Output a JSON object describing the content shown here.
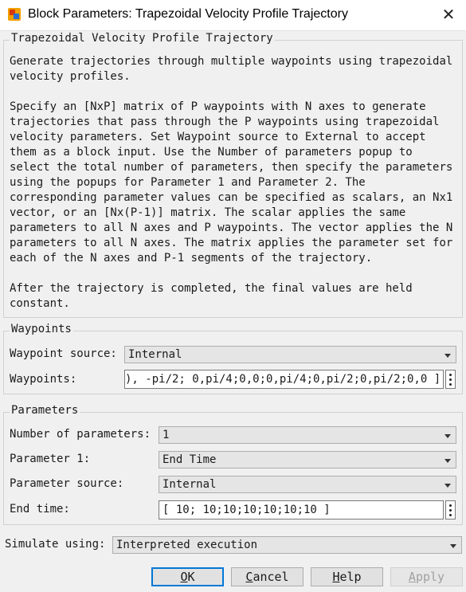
{
  "window": {
    "title": "Block Parameters: Trapezoidal Velocity Profile Trajectory",
    "close_glyph": "✕"
  },
  "block": {
    "name": "Trapezoidal Velocity Profile Trajectory",
    "description": "Generate trajectories through multiple waypoints using trapezoidal\nvelocity profiles.\n\nSpecify an [NxP] matrix of P waypoints with N axes to generate\ntrajectories that pass through the P waypoints using trapezoidal\nvelocity parameters. Set Waypoint source to External to accept\nthem as a block input. Use the Number of parameters popup to\nselect the total number of parameters, then specify the parameters\nusing the popups for Parameter 1 and Parameter 2. The\ncorresponding parameter values can be specified as scalars, an Nx1\nvector, or an [Nx(P-1)] matrix. The scalar applies the same\nparameters to all N axes and P waypoints. The vector applies the N\nparameters to all N axes. The matrix applies the parameter set for\neach of the N axes and P-1 segments of the trajectory.\n\nAfter the trajectory is completed, the final values are held\nconstant."
  },
  "waypoints": {
    "group_title": "Waypoints",
    "source_label": "Waypoint source:",
    "source_value": "Internal",
    "waypoints_label": "Waypoints:",
    "waypoints_value": "), -pi/2; 0,pi/4;0,0;0,pi/4;0,pi/2;0,pi/2;0,0 ]"
  },
  "parameters": {
    "group_title": "Parameters",
    "num_label": "Number of parameters:",
    "num_value": "1",
    "param1_label": "Parameter 1:",
    "param1_value": "End Time",
    "source_label": "Parameter source:",
    "source_value": "Internal",
    "endtime_label": "End time:",
    "endtime_value": "[ 10; 10;10;10;10;10;10 ]"
  },
  "simulate": {
    "label": "Simulate using:",
    "value": "Interpreted execution"
  },
  "buttons": {
    "ok": {
      "first": "O",
      "rest": "K"
    },
    "cancel": {
      "first": "C",
      "rest": "ancel"
    },
    "help": {
      "first": "H",
      "rest": "elp"
    },
    "apply": {
      "first": "A",
      "rest": "pply"
    }
  },
  "icons": {
    "app": "simulink-block-icon",
    "close": "close-icon",
    "dropdown": "chevron-down-icon",
    "more": "vertical-ellipsis-icon"
  }
}
